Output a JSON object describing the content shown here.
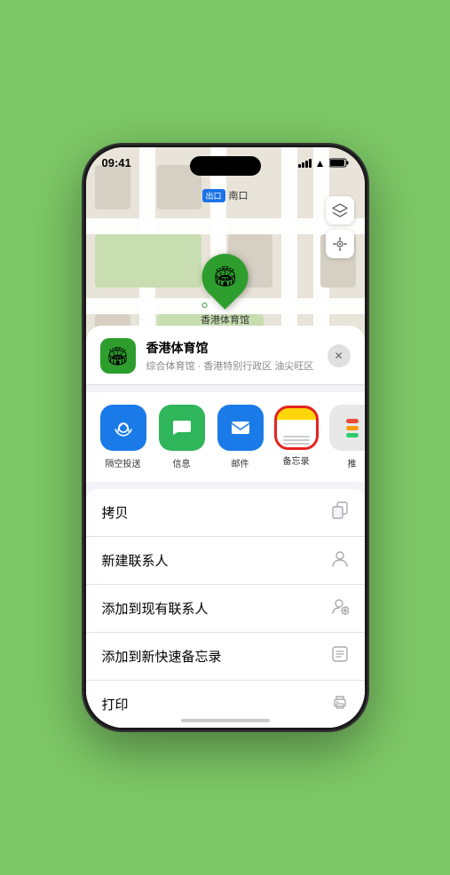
{
  "status_bar": {
    "time": "09:41",
    "location_arrow": "▲"
  },
  "map": {
    "label_tag": "出口",
    "label_text": "南口",
    "venue_name": "香港体育馆"
  },
  "map_controls": {
    "layers_icon": "🗺",
    "location_icon": "⌖"
  },
  "venue_info": {
    "title": "香港体育馆",
    "subtitle": "综合体育馆 · 香港特别行政区 油尖旺区",
    "pin_emoji": "🏟"
  },
  "share_items": [
    {
      "id": "airdrop",
      "label": "隔空投送"
    },
    {
      "id": "message",
      "label": "信息"
    },
    {
      "id": "mail",
      "label": "邮件"
    },
    {
      "id": "notes",
      "label": "备忘录"
    },
    {
      "id": "more",
      "label": "推"
    }
  ],
  "action_rows": [
    {
      "label": "拷贝",
      "icon": "⧉"
    },
    {
      "label": "新建联系人",
      "icon": "👤"
    },
    {
      "label": "添加到现有联系人",
      "icon": "👤"
    },
    {
      "label": "添加到新快速备忘录",
      "icon": "⊞"
    },
    {
      "label": "打印",
      "icon": "🖨"
    }
  ]
}
